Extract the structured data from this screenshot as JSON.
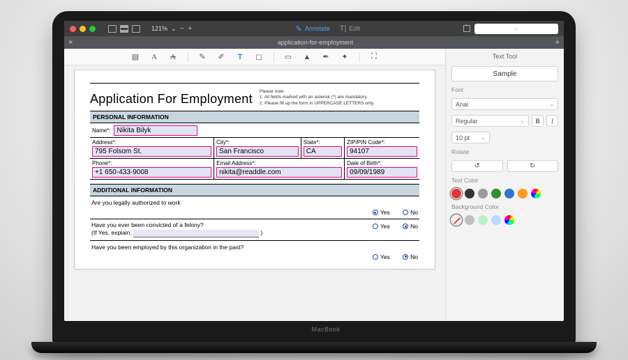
{
  "titlebar": {
    "zoom_pct": "121%",
    "zoom_chev": "⌄",
    "minus": "−",
    "plus": "+",
    "annotate_label": "Annotate",
    "edit_label": "Edit",
    "search_placeholder": "⌕"
  },
  "tab": {
    "close": "×",
    "name": "application-for-employment",
    "add": "+"
  },
  "anntoolbar": {
    "icons": [
      "highlight",
      "font-a",
      "font-a2",
      "pencil",
      "eraser",
      "text-t",
      "shape",
      "note",
      "stamp",
      "signature",
      "eyedrop",
      "fullscreen"
    ]
  },
  "doc": {
    "title": "Application For Employment",
    "notes_hdr": "Please note:",
    "note1": "1. All fields marked with an asterisk (*) are mandatory.",
    "note2": "2. Please fill up the form in UPPERCASE LETTERS only.",
    "section_personal": "PERSONAL INFORMATION",
    "section_additional": "ADDITIONAL INFORMATION",
    "fields": {
      "name_lbl": "Name*:",
      "name_val": "Nikita Bilyk",
      "address_lbl": "Address*:",
      "address_val": "795 Folsom St.",
      "city_lbl": "City*:",
      "city_val": "San Francisco",
      "state_lbl": "State*:",
      "state_val": "CA",
      "zip_lbl": "ZIP/PIN Code*:",
      "zip_val": "94107",
      "phone_lbl": "Phone*:",
      "phone_val": "+1 650-433-9008",
      "email_lbl": "Email Address*:",
      "email_val": "nikita@readdle.com",
      "dob_lbl": "Date of Birth*:",
      "dob_val": "09/09/1989"
    },
    "q1": "Are you legally authorized to work",
    "q2a": "Have you ever been convicted of a felony?",
    "q2b": "(If Yes, explain:",
    "q2c": ")",
    "q3": "Have you been employed by this organization in the past?",
    "yes": "Yes",
    "no": "No"
  },
  "panel": {
    "title": "Text Tool",
    "sample": "Sample",
    "font_lbl": "Font",
    "font_val": "Arial",
    "weight_val": "Regular",
    "bold": "B",
    "italic": "I",
    "size_val": "10 pt",
    "rotate_lbl": "Rotate",
    "rot_l": "↺",
    "rot_r": "↻",
    "textcolor_lbl": "Text Color",
    "bgcolor_lbl": "Background Color",
    "text_colors": [
      "#e53333",
      "#333333",
      "#9a9a9a",
      "#2f8f2f",
      "#2d74d6",
      "#ff9a1f",
      "#8a3fbf"
    ],
    "bg_colors": [
      "none",
      "#bfbfbf",
      "#b9f2c9",
      "#b8dcff",
      "rainbow"
    ]
  },
  "brand": "MacBook"
}
